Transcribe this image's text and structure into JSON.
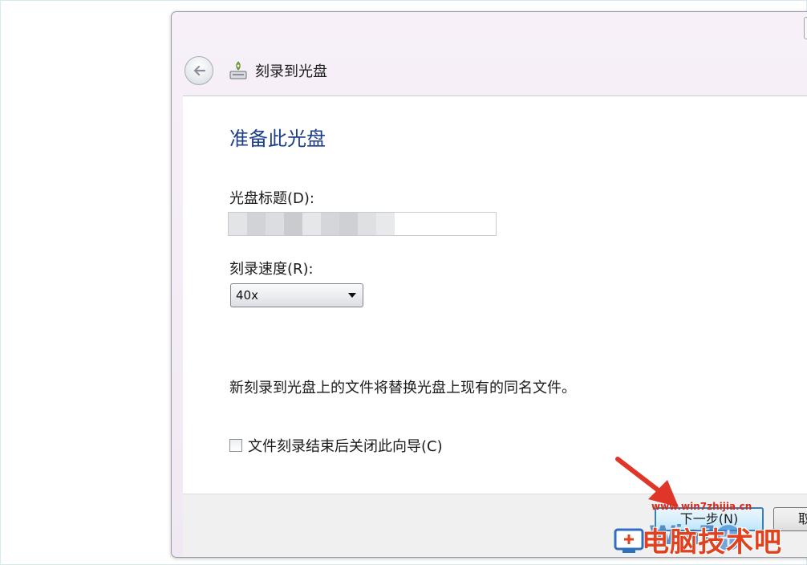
{
  "window": {
    "title": "刻录到光盘"
  },
  "content": {
    "heading": "准备此光盘",
    "disc_title_label": "光盘标题(D):",
    "disc_title_value": "",
    "speed_label": "刻录速度(R):",
    "speed_value": "40x",
    "replace_note": "新刻录到光盘上的文件将替换光盘上现有的同名文件。",
    "close_checkbox_label": "文件刻录结束后关闭此向导(C)",
    "close_checkbox_checked": false
  },
  "footer": {
    "next_label": "下一步(N)",
    "cancel_label": "取消"
  },
  "watermark": {
    "url": "www.win7zhijia.cn",
    "brand": "电脑技术吧"
  },
  "icons": [
    "back-arrow-icon",
    "burn-disc-icon",
    "dropdown-arrow-icon",
    "red-pointer-arrow-icon",
    "watermark-logo-icon"
  ],
  "colors": {
    "heading": "#1e3e8c",
    "next_button_border": "#3c7fb1",
    "arrow": "#e0362a",
    "watermark_brand": "#e0411f"
  }
}
